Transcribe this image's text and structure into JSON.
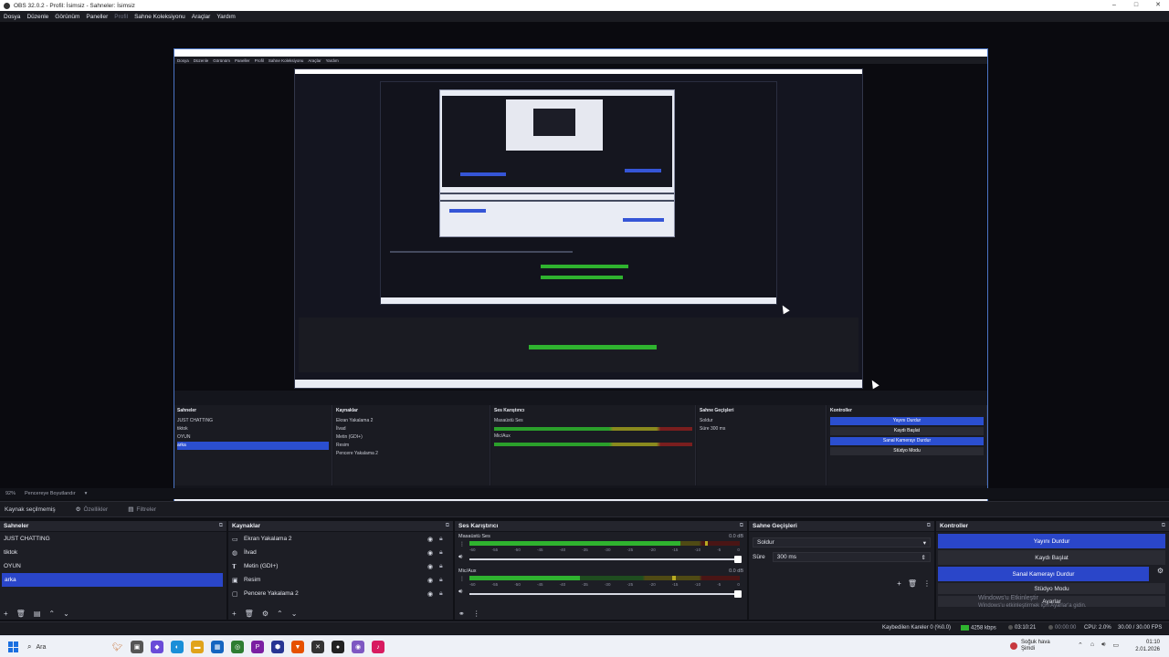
{
  "window": {
    "title": "OBS 32.0.2 - Profil: İsimsiz - Sahneler: İsimsiz"
  },
  "menu": [
    "Dosya",
    "Düzenle",
    "Görünüm",
    "Paneller",
    "Profil",
    "Sahne Koleksiyonu",
    "Araçlar",
    "Yardım"
  ],
  "zoom": {
    "value": "92%",
    "mode": "Pencereye Boyutlandır"
  },
  "source_bar": {
    "label": "Kaynak seçilmemiş",
    "properties": "Özellikler",
    "filters": "Filtreler"
  },
  "scenes": {
    "title": "Sahneler",
    "items": [
      "JUST CHATTING",
      "tiktok",
      "OYUN",
      "arka"
    ],
    "selected": "arka"
  },
  "sources": {
    "title": "Kaynaklar",
    "items": [
      {
        "name": "Ekran Yakalama 2",
        "icon": "monitor-icon"
      },
      {
        "name": "İlvad",
        "icon": "globe-icon"
      },
      {
        "name": "Metin (GDI+)",
        "icon": "text-icon"
      },
      {
        "name": "Resim",
        "icon": "image-icon"
      },
      {
        "name": "Pencere Yakalama 2",
        "icon": "window-icon"
      }
    ]
  },
  "mixer": {
    "title": "Ses Karıştırıcı",
    "channels": [
      {
        "name": "Masaüstü Ses",
        "db": "0.0 dB",
        "level": 0.78,
        "peak": 0.87
      },
      {
        "name": "Mic/Aux",
        "db": "0.0 dB",
        "level": 0.41,
        "peak": 0.75
      }
    ],
    "ticks": [
      "-60",
      "-55",
      "-50",
      "-45",
      "-40",
      "-35",
      "-30",
      "-25",
      "-20",
      "-15",
      "-10",
      "-5",
      "0"
    ]
  },
  "transitions": {
    "title": "Sahne Geçişleri",
    "selected": "Soldur",
    "duration_label": "Süre",
    "duration_value": "300 ms"
  },
  "controls": {
    "title": "Kontroller",
    "stop_stream": "Yayını Durdur",
    "start_record": "Kaydı Başlat",
    "stop_virtualcam": "Sanal Kamerayı Durdur",
    "studio_mode": "Stüdyo Modu",
    "settings": "Ayarlar",
    "watermark_title": "Windows'u Etkinleştir",
    "watermark_sub": "Windows'u etkinleştirmek için Ayarlar'a gidin."
  },
  "status": {
    "dropped": "Kaybedilen Kareler 0 (%0.0)",
    "bitrate": "4258 kbps",
    "stream_time": "03:10:21",
    "rec_time": "00:00:00",
    "cpu": "CPU: 2.0%",
    "fps": "30.00 / 30.00 FPS"
  },
  "taskbar": {
    "search": "Ara",
    "weather_title": "Soğuk hava",
    "weather_sub": "Şimdi",
    "time": "01:10",
    "date": "2.01.2026",
    "tray_text": "ENG"
  },
  "colors": {
    "accent": "#2a46c9",
    "panel": "#1d1e25",
    "meter_green": "#2fb32f",
    "meter_yellow": "#b8aa22"
  }
}
